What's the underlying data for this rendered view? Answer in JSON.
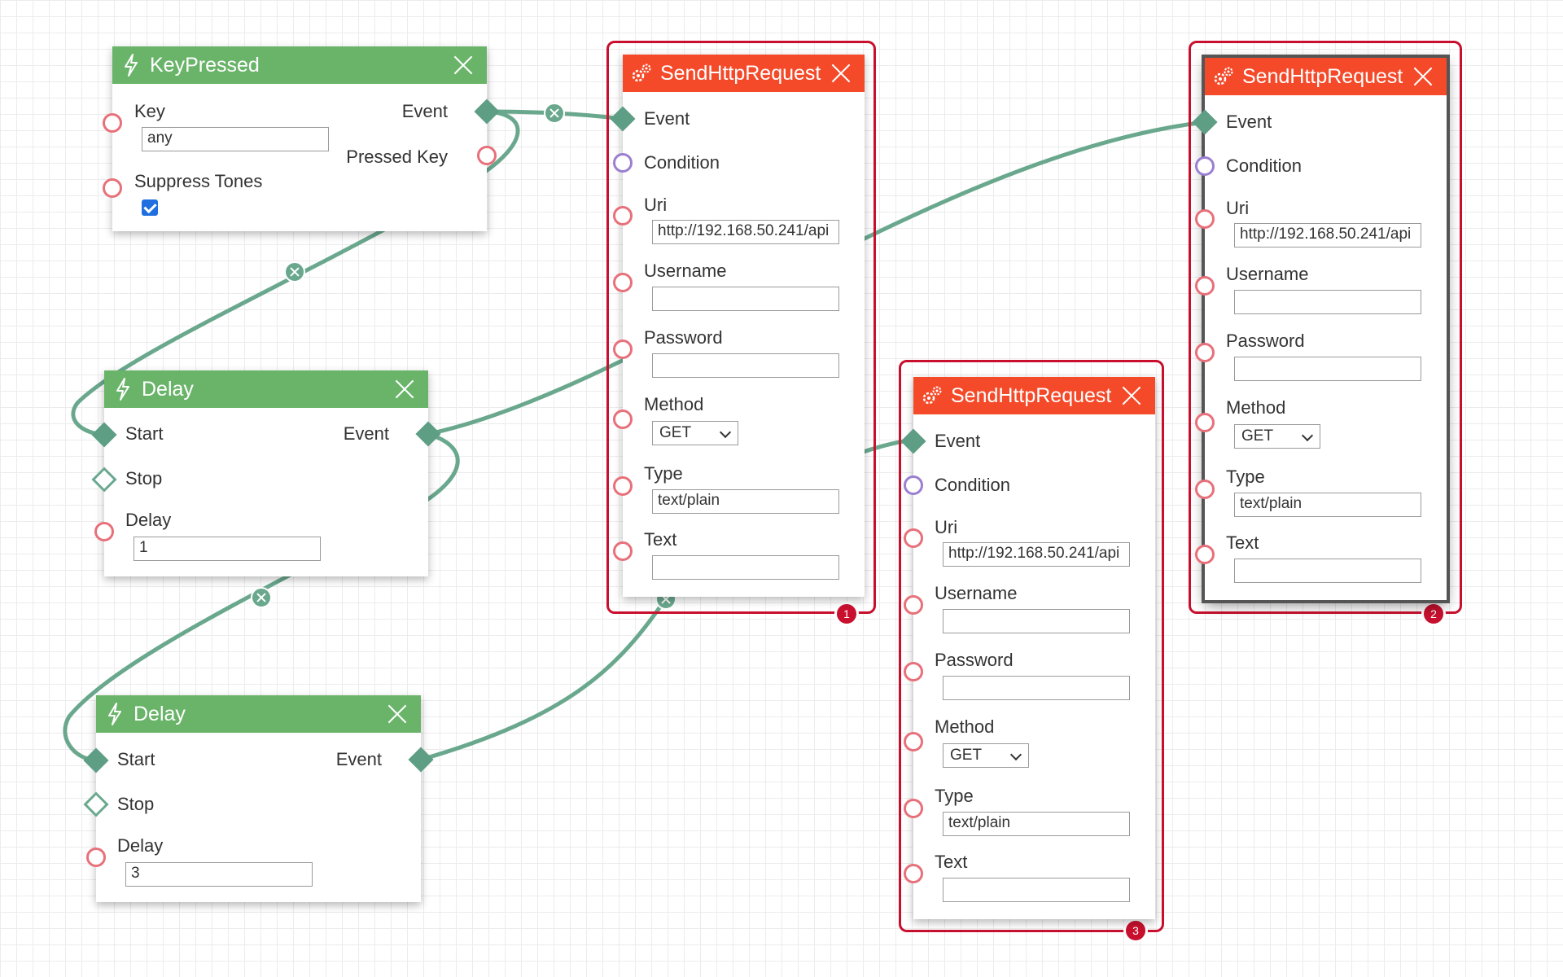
{
  "colors": {
    "wire": "#6aa88e",
    "action_header": "#f44a2a",
    "trigger_header": "#6ab46a",
    "frame": "#c8102e"
  },
  "nodes": {
    "keypressed": {
      "title": "KeyPressed",
      "key_label": "Key",
      "key_value": "any",
      "event_label": "Event",
      "pressed_key_label": "Pressed Key",
      "suppress_label": "Suppress Tones",
      "suppress_checked": true
    },
    "delay1": {
      "title": "Delay",
      "start_label": "Start",
      "stop_label": "Stop",
      "event_label": "Event",
      "delay_label": "Delay",
      "delay_value": "1"
    },
    "delay2": {
      "title": "Delay",
      "start_label": "Start",
      "stop_label": "Stop",
      "event_label": "Event",
      "delay_label": "Delay",
      "delay_value": "3"
    },
    "http1": {
      "title": "SendHttpRequest",
      "event_label": "Event",
      "condition_label": "Condition",
      "uri_label": "Uri",
      "uri_value": "http://192.168.50.241/api",
      "username_label": "Username",
      "username_value": "",
      "password_label": "Password",
      "password_value": "",
      "method_label": "Method",
      "method_value": "GET",
      "type_label": "Type",
      "type_value": "text/plain",
      "text_label": "Text",
      "text_value": "",
      "badge": "1"
    },
    "http2": {
      "title": "SendHttpRequest",
      "event_label": "Event",
      "condition_label": "Condition",
      "uri_label": "Uri",
      "uri_value": "http://192.168.50.241/api",
      "username_label": "Username",
      "username_value": "",
      "password_label": "Password",
      "password_value": "",
      "method_label": "Method",
      "method_value": "GET",
      "type_label": "Type",
      "type_value": "text/plain",
      "text_label": "Text",
      "text_value": "",
      "badge": "2"
    },
    "http3": {
      "title": "SendHttpRequest",
      "event_label": "Event",
      "condition_label": "Condition",
      "uri_label": "Uri",
      "uri_value": "http://192.168.50.241/api",
      "username_label": "Username",
      "username_value": "",
      "password_label": "Password",
      "password_value": "",
      "method_label": "Method",
      "method_value": "GET",
      "type_label": "Type",
      "type_value": "text/plain",
      "text_label": "Text",
      "text_value": "",
      "badge": "3"
    }
  },
  "connections": [
    {
      "from": "keypressed.event",
      "to": "http1.event"
    },
    {
      "from": "keypressed.event",
      "to": "delay1.start"
    },
    {
      "from": "delay1.event",
      "to": "http2.event"
    },
    {
      "from": "delay1.event",
      "to": "delay2.start"
    },
    {
      "from": "delay2.event",
      "to": "http3.event"
    }
  ]
}
